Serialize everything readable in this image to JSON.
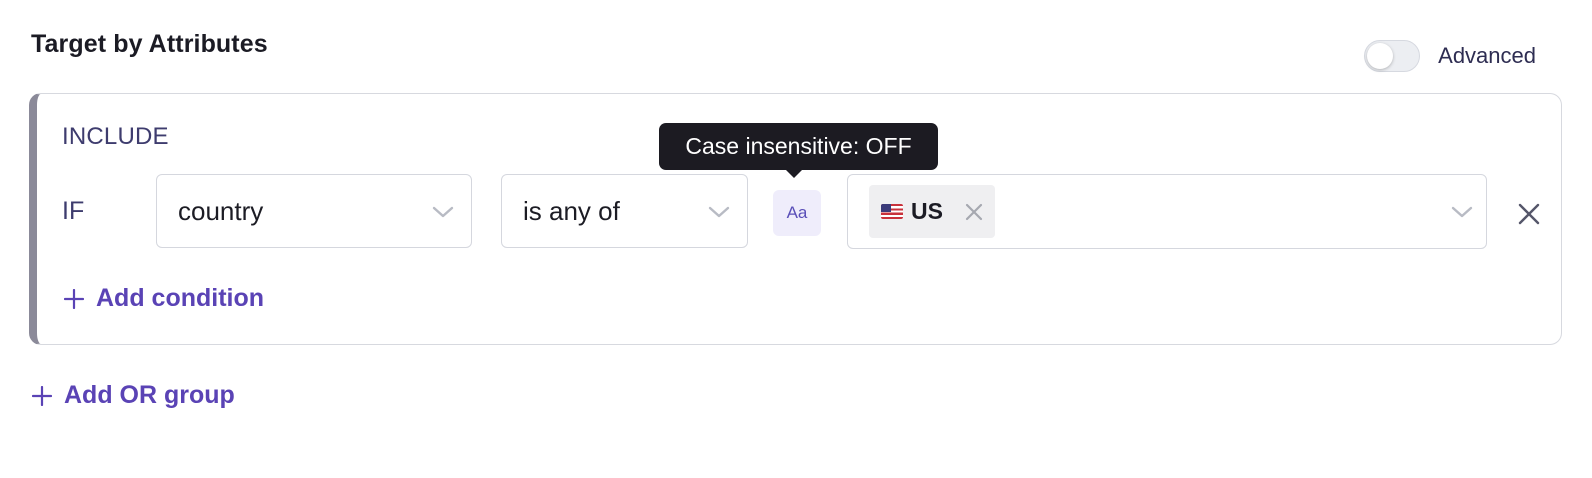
{
  "section": {
    "title": "Target by Attributes"
  },
  "advanced": {
    "label": "Advanced",
    "enabled": false
  },
  "group": {
    "mode_label": "INCLUDE",
    "condition": {
      "if_label": "IF",
      "attribute": "country",
      "operator": "is any of",
      "case_button_label": "Aa",
      "case_tooltip": "Case insensitive: OFF",
      "values": [
        {
          "flag_icon": "us-flag-icon",
          "label": "US"
        }
      ]
    },
    "add_condition_label": "Add condition"
  },
  "add_or_group_label": "Add OR group",
  "colors": {
    "accent": "#5a43b5",
    "text_dark": "#1b1b24",
    "label_muted": "#3e3c6e",
    "tooltip_bg": "#1c1b22",
    "group_border_left": "#8b8a99"
  }
}
